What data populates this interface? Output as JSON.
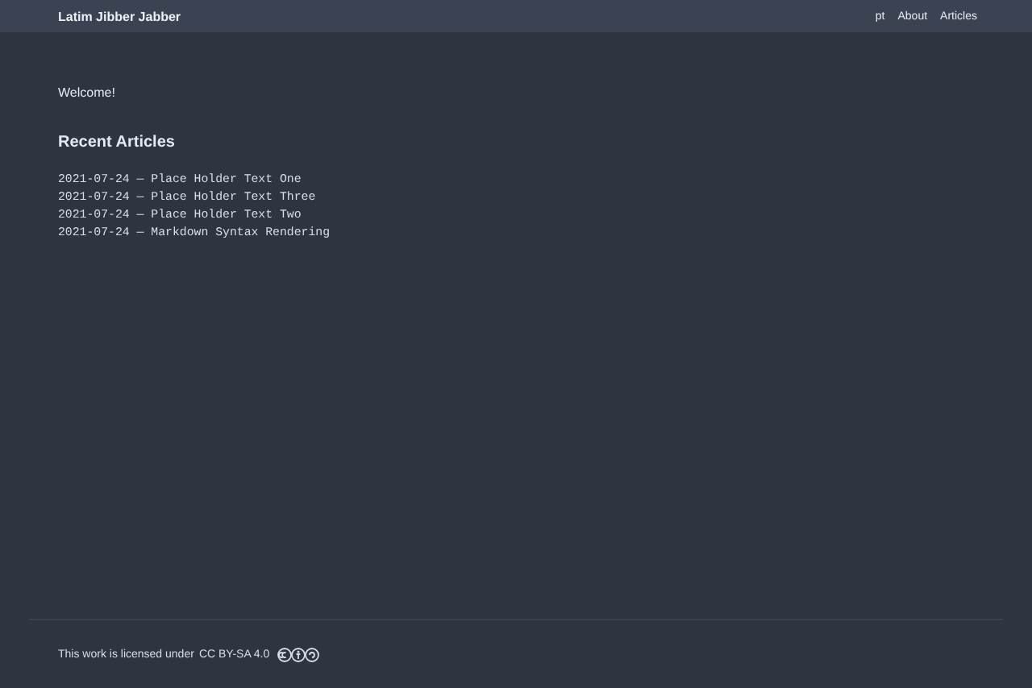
{
  "header": {
    "site_title": "Latim Jibber Jabber",
    "nav": [
      "pt",
      "About",
      "Articles"
    ]
  },
  "welcome": "Welcome!",
  "recent": {
    "heading": "Recent Articles",
    "articles": [
      "2021-07-24 — Place Holder Text One",
      "2021-07-24 — Place Holder Text Three",
      "2021-07-24 — Place Holder Text Two",
      "2021-07-24 — Markdown Syntax Rendering"
    ]
  },
  "footer": {
    "license_text": "This work is licensed under",
    "license_link": "CC BY-SA 4.0"
  }
}
